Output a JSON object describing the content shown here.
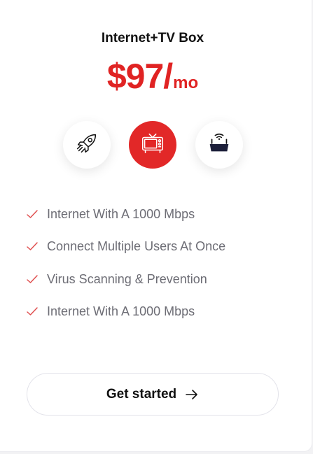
{
  "plan": {
    "title": "Internet+TV Box",
    "price_amount": "$97",
    "price_slash": "/",
    "price_unit": "mo"
  },
  "options": [
    {
      "icon": "rocket-icon",
      "selected": false
    },
    {
      "icon": "tv-icon",
      "selected": true
    },
    {
      "icon": "router-box-icon",
      "selected": false
    }
  ],
  "features": [
    "Internet With A 1000 Mbps",
    "Connect Multiple Users At Once",
    "Virus Scanning & Prevention",
    "Internet With A 1000 Mbps"
  ],
  "cta": {
    "label": "Get started",
    "icon": "arrow-right-icon"
  },
  "colors": {
    "accent": "#e22828",
    "text": "#111111",
    "muted": "#6d6d75",
    "check": "#e05050"
  }
}
